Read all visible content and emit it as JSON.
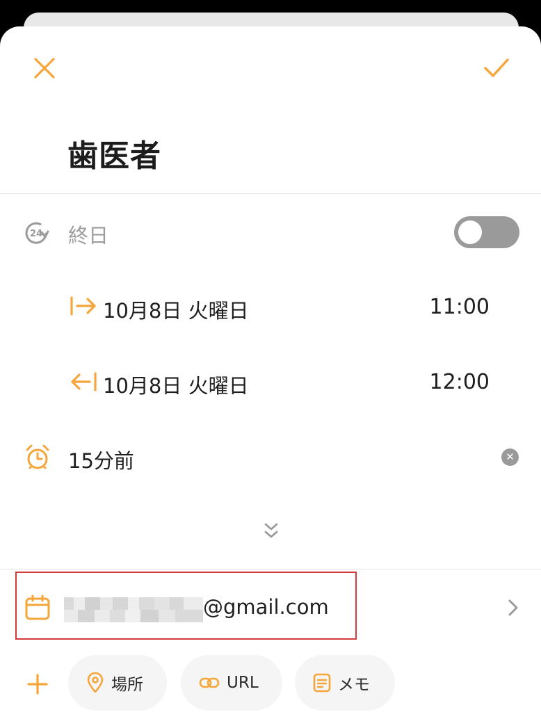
{
  "event": {
    "title": "歯医者"
  },
  "all_day": {
    "label": "終日",
    "enabled": false
  },
  "start": {
    "date": "10月8日 火曜日",
    "time": "11:00"
  },
  "end": {
    "date": "10月8日 火曜日",
    "time": "12:00"
  },
  "alert": {
    "label": "15分前"
  },
  "account": {
    "email_suffix": "@gmail.com"
  },
  "actions": {
    "location": "場所",
    "url": "URL",
    "memo": "メモ"
  },
  "colors": {
    "accent": "#F5A53A",
    "toggle_off": "#9A9A9A",
    "highlight_border": "#D23B3B"
  }
}
